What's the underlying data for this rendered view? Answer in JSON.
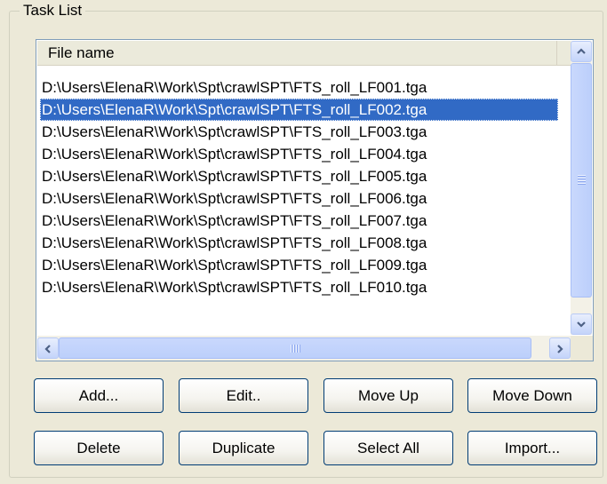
{
  "group": {
    "title": "Task List"
  },
  "list": {
    "column_header": "File name",
    "selected_index": 1,
    "rows": [
      "D:\\Users\\ElenaR\\Work\\Spt\\crawlSPT\\FTS_roll_LF001.tga",
      "D:\\Users\\ElenaR\\Work\\Spt\\crawlSPT\\FTS_roll_LF002.tga",
      "D:\\Users\\ElenaR\\Work\\Spt\\crawlSPT\\FTS_roll_LF003.tga",
      "D:\\Users\\ElenaR\\Work\\Spt\\crawlSPT\\FTS_roll_LF004.tga",
      "D:\\Users\\ElenaR\\Work\\Spt\\crawlSPT\\FTS_roll_LF005.tga",
      "D:\\Users\\ElenaR\\Work\\Spt\\crawlSPT\\FTS_roll_LF006.tga",
      "D:\\Users\\ElenaR\\Work\\Spt\\crawlSPT\\FTS_roll_LF007.tga",
      "D:\\Users\\ElenaR\\Work\\Spt\\crawlSPT\\FTS_roll_LF008.tga",
      "D:\\Users\\ElenaR\\Work\\Spt\\crawlSPT\\FTS_roll_LF009.tga",
      "D:\\Users\\ElenaR\\Work\\Spt\\crawlSPT\\FTS_roll_LF010.tga"
    ]
  },
  "buttons": {
    "add": "Add...",
    "edit": "Edit..",
    "move_up": "Move Up",
    "move_down": "Move Down",
    "delete": "Delete",
    "duplicate": "Duplicate",
    "select_all": "Select All",
    "import": "Import..."
  },
  "icons": {
    "scroll_up": "chevron-up-icon",
    "scroll_down": "chevron-down-icon",
    "scroll_left": "chevron-left-icon",
    "scroll_right": "chevron-right-icon"
  },
  "colors": {
    "selection": "#316ac5",
    "scrollbar": "#c1d3fb",
    "window_bg": "#ece9d8"
  }
}
